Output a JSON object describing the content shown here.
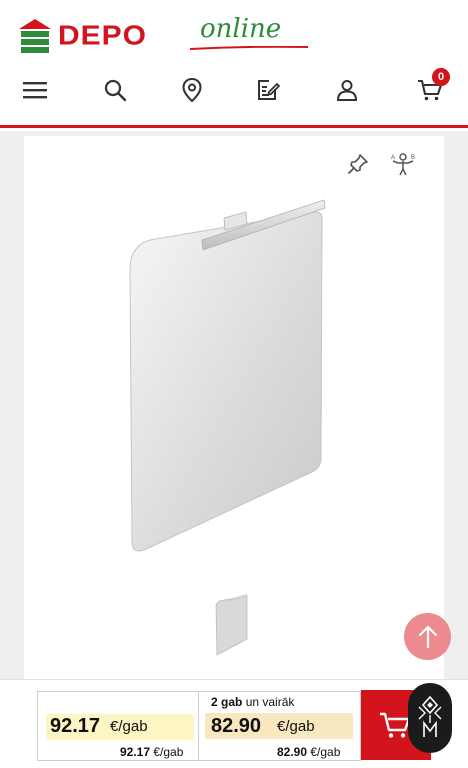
{
  "brand": {
    "name": "DEPO",
    "tagline": "online",
    "colors": {
      "red": "#d4141c",
      "green": "#2e8b3a"
    }
  },
  "nav": {
    "items": [
      {
        "name": "menu-icon"
      },
      {
        "name": "search-icon"
      },
      {
        "name": "location-pin-icon"
      },
      {
        "name": "shopping-list-icon"
      },
      {
        "name": "account-icon"
      },
      {
        "name": "cart-icon"
      }
    ],
    "cart_count": "0"
  },
  "gallery": {
    "tools": [
      {
        "name": "pin-icon"
      },
      {
        "name": "compare-icon"
      }
    ],
    "product_image": "mirror-with-led-light",
    "thumbnails": 1
  },
  "pricing": {
    "single": {
      "price": "92.17",
      "unit": "€/gab",
      "sub_price": "92.17",
      "sub_unit": "€/gab"
    },
    "bulk": {
      "qty": "2 gab",
      "qty_suffix": "un vairāk",
      "price": "82.90",
      "unit": "€/gab",
      "sub_price": "82.90",
      "sub_unit": "€/gab"
    },
    "highlight_colors": {
      "single": "#fdf6c4",
      "bulk": "#f8e7bf"
    }
  },
  "actions": {
    "add_to_cart_icon": "cart-plus-icon",
    "scroll_top_icon": "arrow-up-icon",
    "assistant_icon": "accessibility-icon"
  }
}
